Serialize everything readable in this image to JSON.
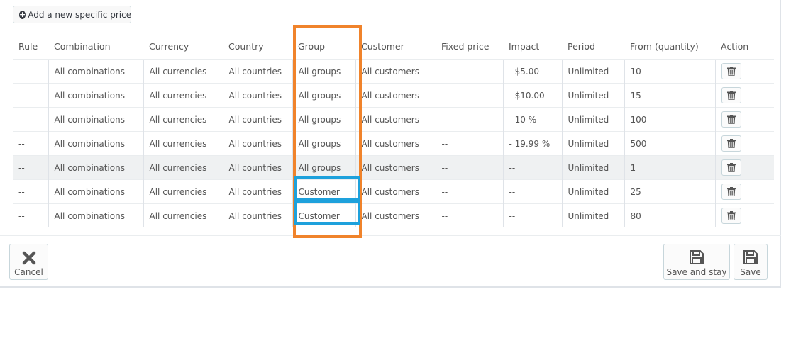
{
  "toolbar": {
    "add_label": "Add a new specific price"
  },
  "table": {
    "columns": [
      "Rule",
      "Combination",
      "Currency",
      "Country",
      "Group",
      "Customer",
      "Fixed price",
      "Impact",
      "Period",
      "From (quantity)",
      "Action"
    ],
    "rows": [
      [
        "--",
        "All combinations",
        "All currencies",
        "All countries",
        "All groups",
        "All customers",
        "--",
        "- $5.00",
        "Unlimited",
        "10"
      ],
      [
        "--",
        "All combinations",
        "All currencies",
        "All countries",
        "All groups",
        "All customers",
        "--",
        "- $10.00",
        "Unlimited",
        "15"
      ],
      [
        "--",
        "All combinations",
        "All currencies",
        "All countries",
        "All groups",
        "All customers",
        "--",
        "- 10 %",
        "Unlimited",
        "100"
      ],
      [
        "--",
        "All combinations",
        "All currencies",
        "All countries",
        "All groups",
        "All customers",
        "--",
        "- 19.99 %",
        "Unlimited",
        "500"
      ],
      [
        "--",
        "All combinations",
        "All currencies",
        "All countries",
        "All groups",
        "All customers",
        "--",
        "--",
        "Unlimited",
        "1"
      ],
      [
        "--",
        "All combinations",
        "All currencies",
        "All countries",
        "Customer",
        "All customers",
        "--",
        "--",
        "Unlimited",
        "25"
      ],
      [
        "--",
        "All combinations",
        "All currencies",
        "All countries",
        "Customer",
        "All customers",
        "--",
        "--",
        "Unlimited",
        "80"
      ]
    ],
    "highlighted_row": 4
  },
  "footer": {
    "cancel_label": "Cancel",
    "save_stay_label": "Save and stay",
    "save_label": "Save"
  },
  "annotations": {
    "group_column_color": "#f0832b",
    "customer_cells_color": "#1ea1dc"
  },
  "icons": [
    "plus-circle-icon",
    "trash-icon",
    "close-icon",
    "floppy-disk-icon"
  ]
}
